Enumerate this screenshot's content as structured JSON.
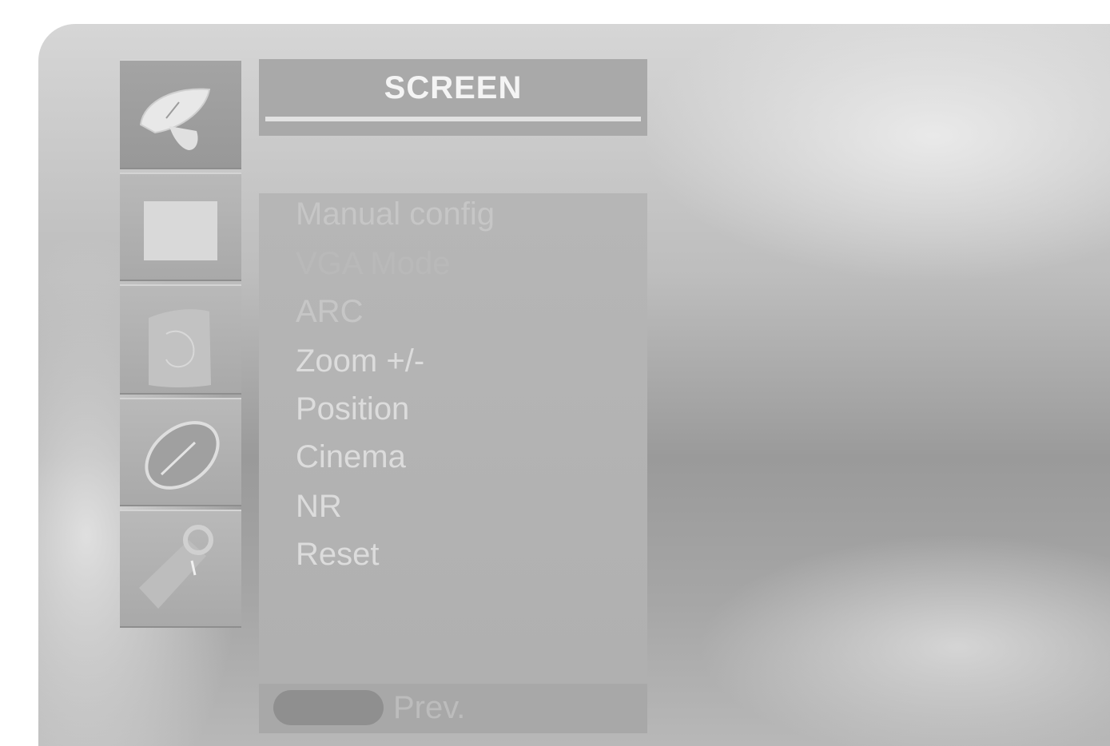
{
  "menu": {
    "title": "SCREEN",
    "items": [
      {
        "label": "Manual config",
        "state": "dim"
      },
      {
        "label": "VGA Mode",
        "state": "hidden"
      },
      {
        "label": "ARC",
        "state": "dim"
      },
      {
        "label": "Zoom +/-",
        "state": "normal"
      },
      {
        "label": "Position",
        "state": "normal"
      },
      {
        "label": "Cinema",
        "state": "normal"
      },
      {
        "label": "NR",
        "state": "normal"
      },
      {
        "label": "Reset",
        "state": "normal"
      }
    ]
  },
  "sidebar": {
    "tabs": [
      {
        "icon": "satellite-dish-icon",
        "active": true
      },
      {
        "icon": "picture-icon",
        "active": false
      },
      {
        "icon": "sound-icon",
        "active": false
      },
      {
        "icon": "time-icon",
        "active": false
      },
      {
        "icon": "option-icon",
        "active": false
      }
    ]
  },
  "footer": {
    "prev_label": "Prev."
  },
  "colors": {
    "panel": "#b0b0b0",
    "text": "#dcdcdc",
    "title_text": "#f4f4f4"
  }
}
